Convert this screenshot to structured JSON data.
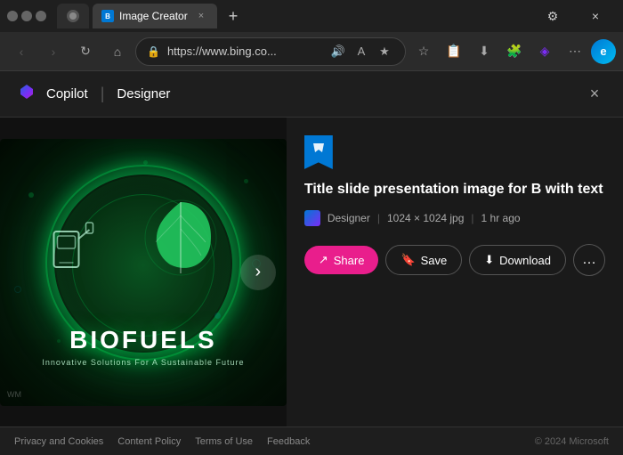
{
  "browser": {
    "tab": {
      "favicon_label": "IC",
      "title": "Image Creator",
      "close_label": "×"
    },
    "new_tab_label": "+",
    "address": "https://www.bing.co...",
    "window_controls": {
      "minimize": "—",
      "maximize": "□",
      "close": "×"
    },
    "nav_buttons": {
      "back": "‹",
      "forward": "›",
      "refresh": "↻",
      "home": "⌂"
    }
  },
  "header": {
    "logo_text": "Copilot",
    "divider": "|",
    "section": "Designer",
    "close": "×"
  },
  "image": {
    "title": "BIOFUELS",
    "subtitle": "Innovative Solutions For A Sustainable Future",
    "watermark": "WM"
  },
  "info": {
    "title": "Title slide presentation image for B with text",
    "meta_source": "Designer",
    "meta_size": "1024 × 1024 jpg",
    "meta_time": "1 hr ago",
    "divider1": "|",
    "divider2": "|"
  },
  "actions": {
    "share_label": "Share",
    "save_label": "Save",
    "download_label": "Download",
    "more_label": "…"
  },
  "footer": {
    "privacy": "Privacy and Cookies",
    "content": "Content Policy",
    "terms": "Terms of Use",
    "feedback": "Feedback",
    "copyright": "© 2024 Microsoft"
  },
  "next_button": "›"
}
